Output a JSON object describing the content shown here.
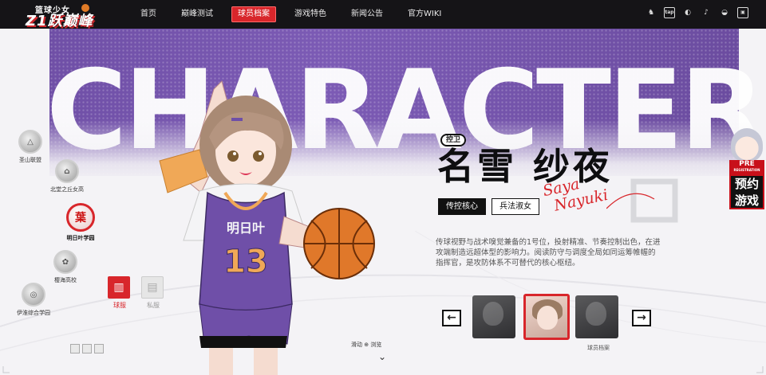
{
  "brand": {
    "logo_small": "篮球少女",
    "logo_big": "Z1跃巅峰"
  },
  "nav": {
    "items": [
      {
        "label": "首页",
        "active": false
      },
      {
        "label": "巅峰测试",
        "active": false
      },
      {
        "label": "球员档案",
        "active": true
      },
      {
        "label": "游戏特色",
        "active": false
      },
      {
        "label": "新闻公告",
        "active": false
      },
      {
        "label": "官方WIKI",
        "active": false
      }
    ]
  },
  "social": {
    "icons": [
      "qq-icon",
      "taptap-icon",
      "bilibili-icon",
      "tiktok-icon",
      "wechat-icon",
      "weibo-icon"
    ],
    "labels": [
      "♞",
      "tap",
      "◐",
      "♪",
      "◒",
      "▣"
    ]
  },
  "hero": {
    "background_word": "CHARACTER",
    "accent_color": "#d8262b",
    "band_color": "#7352a9"
  },
  "schools": [
    {
      "name": "圣山联盟",
      "glyph": "△"
    },
    {
      "name": "北堂之丘女高",
      "glyph": "⌂"
    },
    {
      "name": "明日叶学园",
      "glyph": "葉"
    },
    {
      "name": "樱海高校",
      "glyph": "✿"
    },
    {
      "name": "伊淮综合学园",
      "glyph": "◎"
    }
  ],
  "outfits": {
    "uniform_label": "球服",
    "casual_label": "私服"
  },
  "character": {
    "position": "控卫",
    "name": "名雪 纱夜",
    "tags": [
      "传控核心",
      "兵法淑女"
    ],
    "signature_line1": "Saya",
    "signature_line2": "Nayuki",
    "jersey_team": "明日叶",
    "jersey_number": "13",
    "description": "传球视野与战术嗅觉兼备的1号位，投射精准、节奏控制出色，在进攻端制造远超体型的影响力。阅读防守与调度全局如同运筹帷幄的指挥官，是攻防体系不可替代的核心枢纽。"
  },
  "carousel": {
    "prev_label": "←",
    "next_label": "→",
    "thumbs": [
      {
        "active": false
      },
      {
        "active": true
      },
      {
        "active": false
      }
    ]
  },
  "prereg": {
    "pre_label": "PRE",
    "pre_sub": "REGISTRATION",
    "cta_line1": "预约",
    "cta_line2": "游戏"
  },
  "footer": {
    "scroll_hint": "滑动 ⊕ 浏览",
    "scroll_arrow": "⌄",
    "right_label": "球员档案"
  }
}
